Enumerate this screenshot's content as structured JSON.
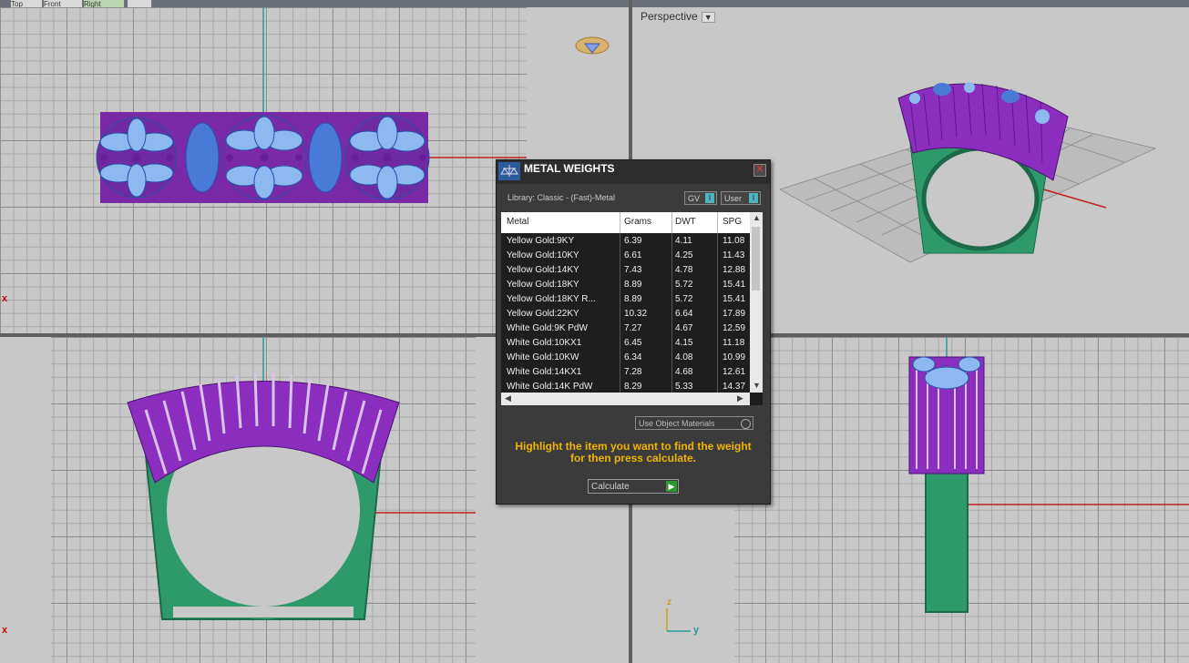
{
  "tabs": [
    "Top",
    "Front",
    "Right",
    ""
  ],
  "viewports": {
    "perspective_label": "Perspective",
    "axis_x_marker": "x",
    "gizmo_z": "z",
    "gizmo_y": "y"
  },
  "dialog": {
    "title": "METAL WEIGHTS",
    "library_label": "Library: Classic - (Fast)-Metal",
    "gv_label": "GV",
    "user_label": "User",
    "columns": [
      "Metal",
      "Grams",
      "DWT",
      "SPG"
    ],
    "rows": [
      {
        "metal": "Yellow Gold:9KY",
        "grams": "6.39",
        "dwt": "4.11",
        "spg": "11.08"
      },
      {
        "metal": "Yellow Gold:10KY",
        "grams": "6.61",
        "dwt": "4.25",
        "spg": "11.43"
      },
      {
        "metal": "Yellow Gold:14KY",
        "grams": "7.43",
        "dwt": "4.78",
        "spg": "12.88"
      },
      {
        "metal": "Yellow Gold:18KY",
        "grams": "8.89",
        "dwt": "5.72",
        "spg": "15.41"
      },
      {
        "metal": "Yellow Gold:18KY R...",
        "grams": "8.89",
        "dwt": "5.72",
        "spg": "15.41"
      },
      {
        "metal": "Yellow Gold:22KY",
        "grams": "10.32",
        "dwt": "6.64",
        "spg": "17.89"
      },
      {
        "metal": "White Gold:9K PdW",
        "grams": "7.27",
        "dwt": "4.67",
        "spg": "12.59"
      },
      {
        "metal": "White Gold:10KX1",
        "grams": "6.45",
        "dwt": "4.15",
        "spg": "11.18"
      },
      {
        "metal": "White Gold:10KW",
        "grams": "6.34",
        "dwt": "4.08",
        "spg": "10.99"
      },
      {
        "metal": "White Gold:14KX1",
        "grams": "7.28",
        "dwt": "4.68",
        "spg": "12.61"
      },
      {
        "metal": "White Gold:14K PdW",
        "grams": "8.29",
        "dwt": "5.33",
        "spg": "14.37"
      }
    ],
    "use_object_materials": "Use Object Materials",
    "hint_line1": "Highlight the item you want to find the weight",
    "hint_line2": "for then press calculate.",
    "calculate_label": "Calculate"
  }
}
